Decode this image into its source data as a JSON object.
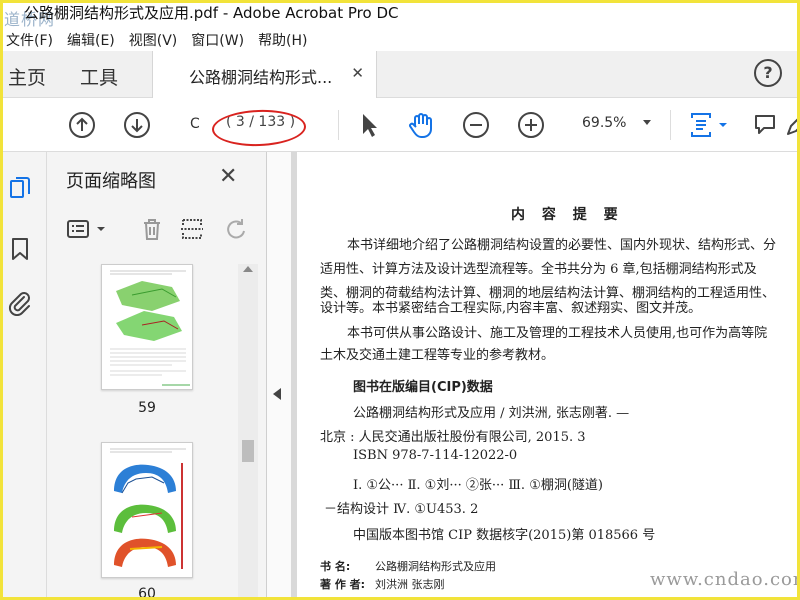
{
  "window": {
    "title": "公路棚洞结构形式及应用.pdf - Adobe Acrobat Pro DC",
    "logo_text": "道桥网"
  },
  "menu": [
    "文件(F)",
    "编辑(E)",
    "视图(V)",
    "窗口(W)",
    "帮助(H)"
  ],
  "tabs": {
    "home": "主页",
    "tools": "工具",
    "document": "公路棚洞结构形式...",
    "help": "?"
  },
  "toolbar": {
    "page_input": "C",
    "page_count": "( 3 / 133 )",
    "zoom": "69.5%"
  },
  "thumbnails": {
    "title": "页面缩略图",
    "pages": [
      {
        "label": "59"
      },
      {
        "label": "60"
      }
    ]
  },
  "document": {
    "heading": "内 容 提 要",
    "summary": [
      "本书详细地介绍了公路棚洞结构设置的必要性、国内外现状、结构形式、分",
      "适用性、计算方法及设计选型流程等。全书共分为 6 章,包括棚洞结构形式及",
      "类、棚洞的荷载结构法计算、棚洞的地层结构法计算、棚洞结构的工程适用性、",
      "设计等。本书紧密结合工程实际,内容丰富、叙述翔实、图文并茂。",
      "本书可供从事公路设计、施工及管理的工程技术人员使用,也可作为高等院",
      "土木及交通土建工程等专业的参考教材。"
    ],
    "cip_heading": "图书在版编目(CIP)数据",
    "cip": [
      "公路棚洞结构形式及应用 / 刘洪洲, 张志刚著. —",
      "北京 : 人民交通出版社股份有限公司, 2015. 3",
      "ISBN 978-7-114-12022-0",
      "Ⅰ. ①公··· Ⅱ. ①刘··· ②张··· Ⅲ. ①棚洞(隧道)",
      "－结构设计 Ⅳ. ①U453. 2",
      "中国版本图书馆 CIP 数据核字(2015)第 018566 号"
    ],
    "book_name_label": "书    名:",
    "book_name": "公路棚洞结构形式及应用",
    "author_label": "著 作 者:",
    "author": "刘洪洲   张志刚"
  },
  "watermark": "www.cndao.com",
  "colors": {
    "accent_blue": "#1473e6",
    "annotation_red": "#d9231f",
    "frame_yellow": "#f2e33a"
  }
}
